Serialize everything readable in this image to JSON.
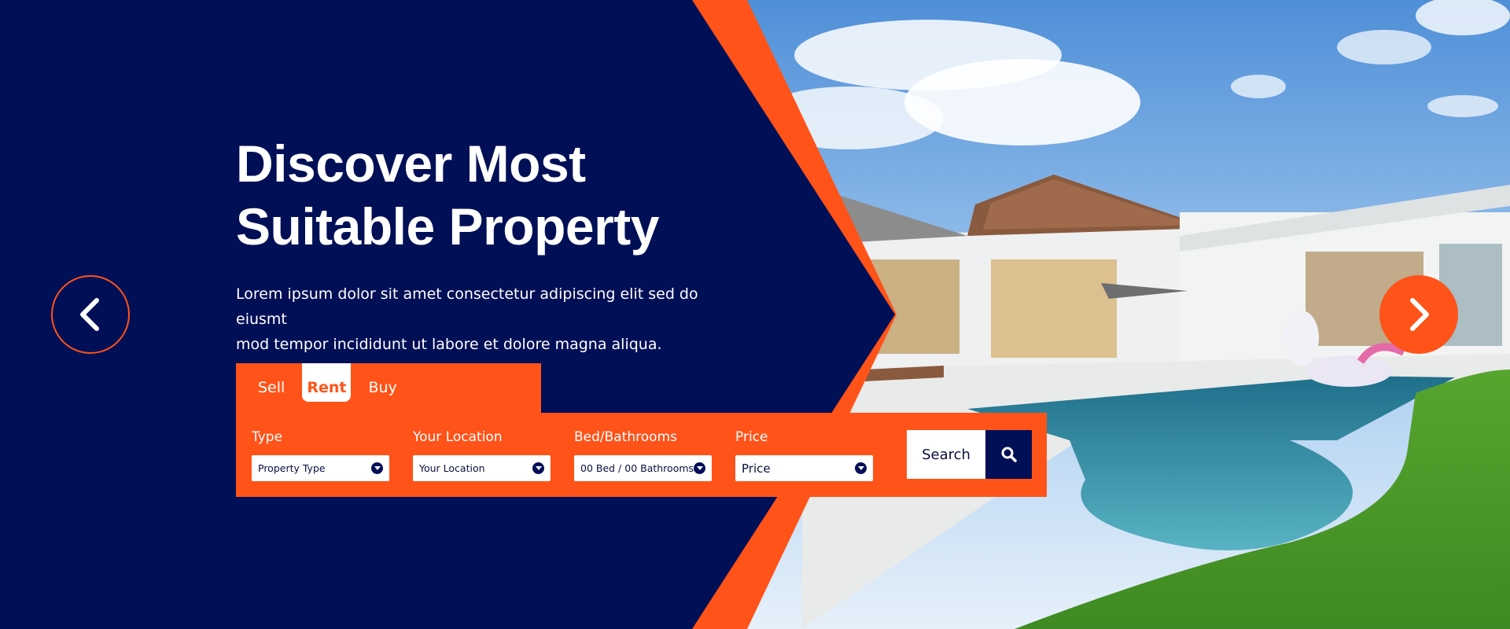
{
  "hero": {
    "title_line1": "Discover Most",
    "title_line2": "Suitable Property",
    "description_line1": "Lorem ipsum dolor sit amet consectetur adipiscing elit sed do eiusmt",
    "description_line2": "mod tempor incididunt ut labore et dolore magna aliqua."
  },
  "carousel": {
    "prev_icon": "chevron-left-icon",
    "next_icon": "chevron-right-icon"
  },
  "search": {
    "tabs": [
      {
        "label": "Sell",
        "active": false
      },
      {
        "label": "Rent",
        "active": true
      },
      {
        "label": "Buy",
        "active": false
      }
    ],
    "fields": [
      {
        "label": "Type",
        "value": "Property Type"
      },
      {
        "label": "Your Location",
        "value": "Your Location"
      },
      {
        "label": "Bed/Bathrooms",
        "value": "00 Bed / 00 Bathrooms"
      },
      {
        "label": "Price",
        "value": "Price"
      }
    ],
    "button_label": "Search",
    "button_icon": "search-icon"
  },
  "colors": {
    "navy": "#010f56",
    "accent_orange": "#ff5319",
    "white": "#ffffff"
  }
}
